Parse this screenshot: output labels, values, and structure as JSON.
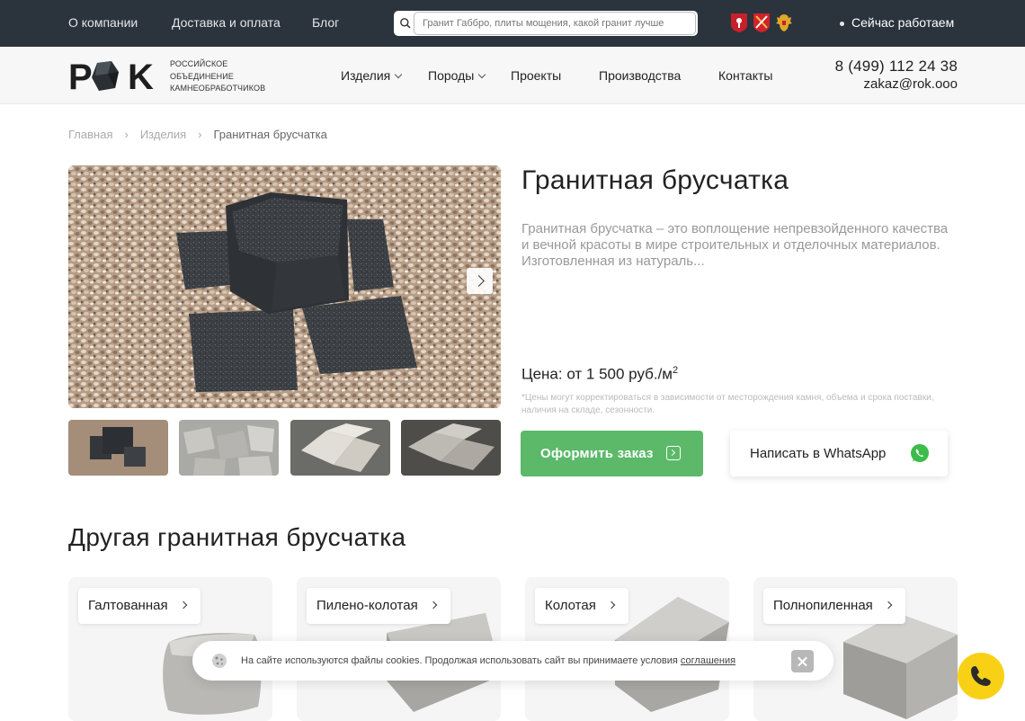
{
  "topbar": {
    "links": [
      "О компании",
      "Доставка и оплата",
      "Блог"
    ],
    "search_placeholder": "Гранит Габбро, плиты мощения, какой гранит лучше",
    "status": "Сейчас работаем"
  },
  "header": {
    "logo_text": "РОК",
    "logo_sub": [
      "РОССИЙСКОЕ",
      "ОБЪЕДИНЕНИЕ",
      "КАМНЕОБРАБОТЧИКОВ"
    ],
    "nav": [
      "Изделия",
      "Породы",
      "Проекты",
      "Производства",
      "Контакты"
    ],
    "phone": "8 (499) 112 24 38",
    "email": "zakaz@rok.ooo"
  },
  "breadcrumb": [
    "Главная",
    "Изделия",
    "Гранитная брусчатка"
  ],
  "product": {
    "title": "Гранитная брусчатка",
    "description": "Гранитная брусчатка – это воплощение непревзойденного качества и вечной красоты в мире строительных и отделочных материалов. Изготовленная из натураль...",
    "price": "Цена: от 1 500 руб./м",
    "price_sup": "2",
    "note": "*Цены могут корректироваться в зависимости от месторождения камня, объема и срока поставки, наличия на складе, сезонности.",
    "order_button": "Оформить заказ",
    "whatsapp_button": "Написать в WhatsApp"
  },
  "related": {
    "title": "Другая гранитная брусчатка",
    "items": [
      "Галтованная",
      "Пилено-колотая",
      "Колотая",
      "Полнопиленная"
    ]
  },
  "cookie": {
    "text": "На сайте используются файлы cookies. Продолжая использовать сайт вы принимаете условия ",
    "link": "соглашения"
  },
  "colors": {
    "topbar_bg": "#2b333c",
    "accent_green": "#5cb96a",
    "call_yellow": "#f8d116",
    "whatsapp_green": "#3dbb4b"
  }
}
